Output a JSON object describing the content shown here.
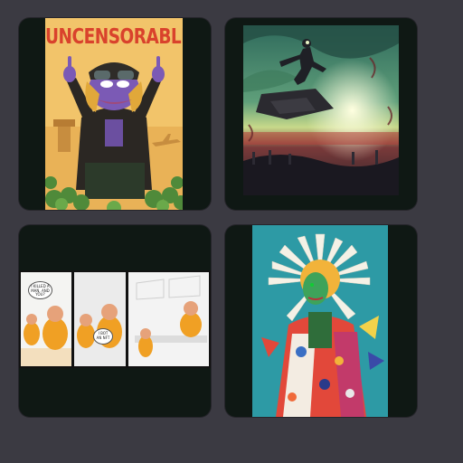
{
  "gallery": {
    "items": [
      {
        "kind": "artwork",
        "title_text": "UNCENSORABLE",
        "icon": "pepe-pilot-poster"
      },
      {
        "kind": "artwork",
        "icon": "surfer-apocalypse-painting"
      },
      {
        "kind": "artwork",
        "icon": "prisoner-comic-strip",
        "bubbles": [
          "I KILLED A MAN, AND YOU?",
          "I BOT AN NFT"
        ]
      },
      {
        "kind": "artwork",
        "icon": "flower-head-figure-painting"
      }
    ]
  },
  "colors": {
    "page_bg": "#3b3a42",
    "card_bg": "#0f1814",
    "title_red": "#d9422c"
  }
}
